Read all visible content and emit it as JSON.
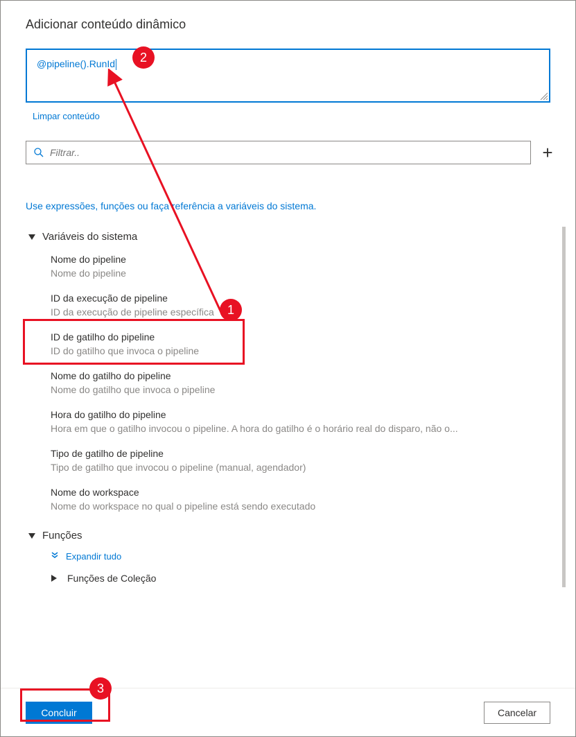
{
  "title": "Adicionar conteúdo dinâmico",
  "expression": "@pipeline().RunId",
  "clear_label": "Limpar conteúdo",
  "filter_placeholder": "Filtrar..",
  "help_text": "Use expressões, funções ou faça referência a variáveis do sistema.",
  "sections": {
    "system_vars": {
      "label": "Variáveis do sistema",
      "items": [
        {
          "title": "Nome do pipeline",
          "desc": "Nome do pipeline"
        },
        {
          "title": "ID da execução de pipeline",
          "desc": "ID da execução de pipeline específica"
        },
        {
          "title": "ID de gatilho do pipeline",
          "desc": "ID do gatilho que invoca o pipeline"
        },
        {
          "title": "Nome do gatilho do pipeline",
          "desc": "Nome do gatilho que invoca o pipeline"
        },
        {
          "title": "Hora do gatilho do pipeline",
          "desc": "Hora em que o gatilho invocou o pipeline. A hora do gatilho é o horário real do disparo, não o..."
        },
        {
          "title": "Tipo de gatilho de pipeline",
          "desc": "Tipo de gatilho que invocou o pipeline (manual, agendador)"
        },
        {
          "title": "Nome do workspace",
          "desc": "Nome do workspace no qual o pipeline está sendo executado"
        }
      ]
    },
    "functions": {
      "label": "Funções",
      "expand_all": "Expandir tudo",
      "collection": "Funções de Coleção"
    }
  },
  "footer": {
    "finish": "Concluir",
    "cancel": "Cancelar"
  },
  "annotations": {
    "b1": "1",
    "b2": "2",
    "b3": "3"
  }
}
